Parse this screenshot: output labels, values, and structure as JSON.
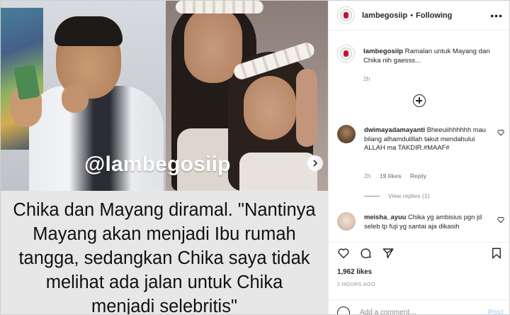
{
  "media": {
    "watermark": "@lambegosiip",
    "caption_lines": [
      "Chika dan Mayang diramal. \"Nantinya",
      "Mayang akan menjadi Ibu rumah",
      "tangga, sedangkan Chika saya tidak",
      "melihat ada jalan untuk Chika",
      "menjadi selebritis\""
    ]
  },
  "header": {
    "username": "lambegosiip",
    "separator": "•",
    "follow_status": "Following",
    "more": "•••"
  },
  "post_caption": {
    "username": "lambegosiip",
    "text": "Ramalan untuk Mayang dan Chika nih gaesss...",
    "time": "2h"
  },
  "comments": [
    {
      "username": "dwimayadamayanti",
      "text": "Bheeuiihhhhhh mau bilang alhamdulillah takut mendahului ALLAH ma TAKDIR.#MAAF#",
      "time": "2h",
      "likes": "19 likes",
      "reply": "Reply",
      "view_replies": "View replies (1)"
    },
    {
      "username": "meisha_ayuu",
      "text": "Chika yg ambisius pgn jd seleb tp fuji yg santai aja dikasih"
    }
  ],
  "stats": {
    "likes": "1,962 likes",
    "ago": "2 HOURS AGO"
  },
  "add_comment": {
    "placeholder": "Add a comment…",
    "post_label": "Post"
  },
  "colors": {
    "link_blue_disabled": "#b3dbff",
    "muted_text": "#8e8e8e",
    "text": "#262626",
    "brand_red": "#c8102e"
  }
}
